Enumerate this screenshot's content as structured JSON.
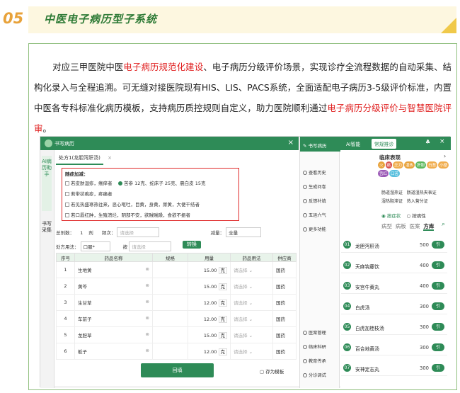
{
  "section": {
    "number": "05",
    "title": "中医电子病历型子系统"
  },
  "paragraph": {
    "p1": "对应三甲医院中医",
    "h1": "电子病历规范化建设",
    "p2": "、电子病历分级评价场景，实现诊疗全流程数据的自动采集、结构化录入与全程追溯。可无缝对接医院现有HIS、LIS、PACS系统，全面适配电子病历3-5级评价标准，内置中医各专科标准化病历模板，支持病历质控规则自定义，助力医院顺利通过",
    "h2": "电子病历分级评价与智慧医院评审",
    "p3": "。"
  },
  "app": {
    "window_title": "书写病历",
    "left_tabs": [
      "AI病历助手",
      "书写采集"
    ],
    "rx_tab": "处方1(龙胆泻肝汤)",
    "options_label": "随症加减：",
    "options": [
      "若皮肤湿疹，瘙痒者",
      "苦参 12克、蛇床子 25克、晨白皮 15克",
      "若带状疱疹，疼痛者",
      "若见热盛寒热往来，恶心呕吐，目黄，身黄，尿黄，大便干结者",
      "若口唇红肿，生殖溃烂，阴部不安，欲贼贼躁，食欲不振者"
    ],
    "form": {
      "total_label": "总剂数：",
      "total_value": "1",
      "unit": "剂",
      "freq_label": "频次：",
      "freq_placeholder": "请选择",
      "reduce_label": "减量：",
      "reduce_value": "全量",
      "usage_label": "处方用法：",
      "usage_value": "口服*",
      "by_label": "按",
      "by_placeholder": "请选择",
      "convert_btn": "转换"
    },
    "table": {
      "headers": [
        "序号",
        "药品名称",
        "规格",
        "用量",
        "药品用法",
        "供应商"
      ],
      "rows": [
        {
          "no": "1",
          "name": "生地黄",
          "dose": "15.00",
          "unit": "克",
          "usage": "请选择",
          "supplier": "国药"
        },
        {
          "no": "2",
          "name": "黄芩",
          "dose": "15.00",
          "unit": "克",
          "usage": "请选择",
          "supplier": "国药"
        },
        {
          "no": "3",
          "name": "生甘草",
          "dose": "12.00",
          "unit": "克",
          "usage": "请选择",
          "supplier": "国药"
        },
        {
          "no": "4",
          "name": "车前子",
          "dose": "12.00",
          "unit": "克",
          "usage": "请选择",
          "supplier": "国药"
        },
        {
          "no": "5",
          "name": "龙胆草",
          "dose": "15.00",
          "unit": "克",
          "usage": "请选择",
          "supplier": "国药"
        },
        {
          "no": "6",
          "name": "栀子",
          "dose": "12.00",
          "unit": "克",
          "usage": "请选择",
          "supplier": "国药"
        }
      ]
    },
    "save_btn": "回填",
    "save_tpl": "存为模板",
    "mid_items": [
      "书写病历",
      "查看历史",
      "生成问卷",
      "反馈补填",
      "五运六气",
      "更多功能",
      "医案管理",
      "临床科研",
      "教育传承",
      "分诊调试"
    ],
    "right": {
      "tabs": [
        "AI智能",
        "常规推诊"
      ],
      "section": "临床表现",
      "tags": [
        "火",
        "痛",
        "乏力",
        "湿热",
        "肝胆",
        "白苔",
        "小便",
        "舌红",
        "口苦"
      ],
      "dx1": "肠道湿热证",
      "dx2": "肠道湿热夹表证",
      "dx3": "湿热阻滞证",
      "dx4": "热入营分证",
      "mode_a": "按症状",
      "mode_b": "按病性",
      "subtabs": [
        "病型",
        "病板",
        "医案",
        "方库"
      ],
      "drugs": [
        {
          "n": "01",
          "name": "龙胆泻肝汤",
          "q": "500",
          "g": "引"
        },
        {
          "n": "02",
          "name": "天麻钩藤饮",
          "q": "400",
          "g": "引"
        },
        {
          "n": "03",
          "name": "安宫牛黄丸",
          "q": "400",
          "g": "引"
        },
        {
          "n": "04",
          "name": "白虎汤",
          "q": "300",
          "g": "引"
        },
        {
          "n": "05",
          "name": "白虎加桂枝汤",
          "q": "300",
          "g": "引"
        },
        {
          "n": "06",
          "name": "百合地黄汤",
          "q": "300",
          "g": "引"
        },
        {
          "n": "07",
          "name": "安神定志丸",
          "q": "300",
          "g": "引"
        }
      ]
    }
  },
  "colors": {
    "accent": "#2e8b57",
    "highlight": "#e02020",
    "number": "#e8a23a"
  }
}
